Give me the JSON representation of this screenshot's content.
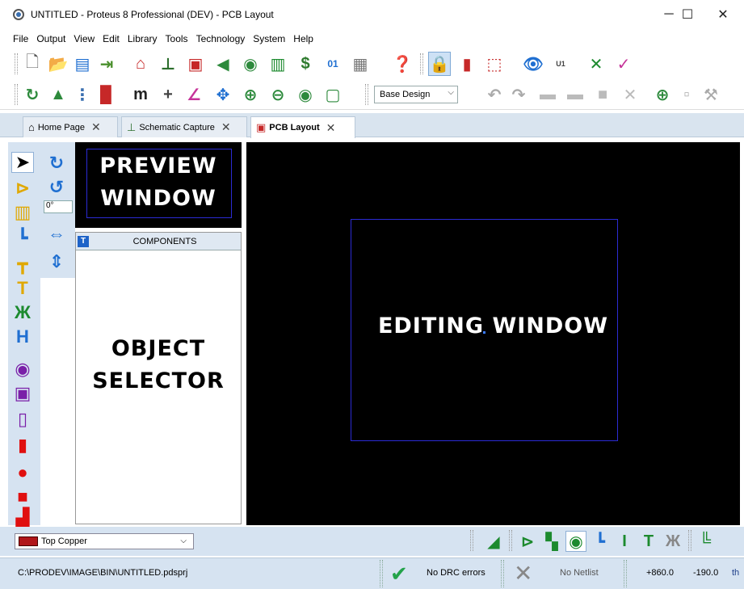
{
  "window": {
    "title": "UNTITLED - Proteus 8 Professional (DEV) - PCB Layout",
    "minimize": "─",
    "maximize": "☐",
    "close": "✕"
  },
  "menu": [
    "File",
    "Output",
    "View",
    "Edit",
    "Library",
    "Tools",
    "Technology",
    "System",
    "Help"
  ],
  "toolbar2": {
    "design_select": "Base Design"
  },
  "tabs": [
    {
      "label": "Home Page",
      "icon": "home-icon",
      "glyph": "⌂",
      "close": "✕"
    },
    {
      "label": "Schematic Capture",
      "icon": "schematic-icon",
      "glyph": "⊥",
      "close": "✕"
    },
    {
      "label": "PCB Layout",
      "icon": "pcb-chip-icon",
      "glyph": "▣",
      "close": "✕",
      "active": true
    }
  ],
  "rotation": {
    "angle": "0°"
  },
  "preview": {
    "label": "PREVIEW\nWINDOW"
  },
  "object_selector": {
    "badge": "T",
    "title": "COMPONENTS",
    "label": "OBJECT\nSELECTOR"
  },
  "editing": {
    "label": "EDITING WINDOW"
  },
  "layer": {
    "selected": "Top Copper",
    "color": "#b0161a"
  },
  "status": {
    "path": "C:\\PRODEV\\IMAGE\\BIN\\UNTITLED.pdsprj",
    "drc": "No DRC errors",
    "netlist": "No Netlist",
    "x": "+860.0",
    "y": "-190.0",
    "units": "th"
  },
  "colors": {
    "canvas": "#000000",
    "board_outline": "#2b2bd4",
    "panel": "#d6e3f1",
    "accent_blue": "#1f6fd1",
    "green": "#1c8a2e"
  }
}
